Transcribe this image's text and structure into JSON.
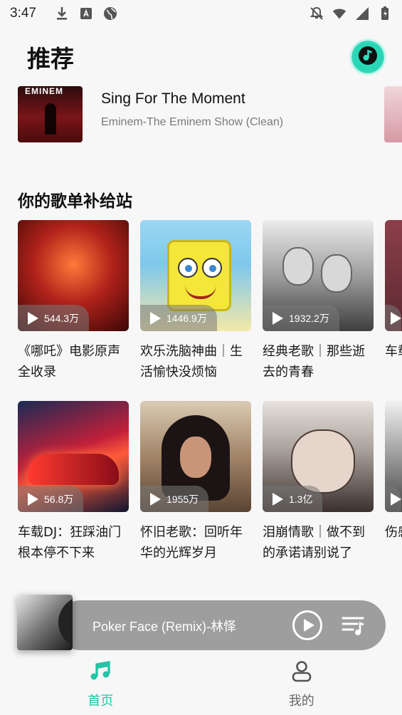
{
  "status_bar": {
    "time": "3:47",
    "left_icons": [
      "download-icon",
      "translate-icon",
      "globe-icon"
    ],
    "right_icons": [
      "notifications-off-icon",
      "wifi-icon",
      "signal-icon",
      "battery-icon"
    ]
  },
  "header": {
    "title": "推荐",
    "music_button_icon": "music-note-icon",
    "accent_color": "#22c4a5"
  },
  "recent_song": {
    "cover_text": "EMINEM",
    "title": "Sing For The Moment",
    "subtitle": "Eminem-The Eminem Show (Clean)"
  },
  "section": {
    "title": "你的歌单补给站",
    "rows": [
      [
        {
          "plays": "544.3万",
          "label": "《哪吒》电影原声全收录"
        },
        {
          "plays": "1446.9万",
          "label": "欢乐洗脑神曲｜生活愉快没烦恼"
        },
        {
          "plays": "1932.2万",
          "label": "经典老歌｜那些逝去的青春"
        },
        {
          "plays": "",
          "label": "车载响彻"
        }
      ],
      [
        {
          "plays": "56.8万",
          "label": "车载DJ：狂踩油门根本停不下来"
        },
        {
          "plays": "1955万",
          "label": "怀旧老歌：回听年华的光辉岁月"
        },
        {
          "plays": "1.3亿",
          "label": "泪崩情歌｜做不到的承诺请别说了"
        },
        {
          "plays": "",
          "label": "伤感待失"
        }
      ]
    ]
  },
  "player": {
    "title": "Poker Face (Remix)-林怿",
    "play_icon": "play-circle-icon",
    "queue_icon": "playlist-icon"
  },
  "bottom_nav": {
    "home_label": "首页",
    "me_label": "我的",
    "home_icon": "music-note-icon",
    "me_icon": "person-icon"
  }
}
